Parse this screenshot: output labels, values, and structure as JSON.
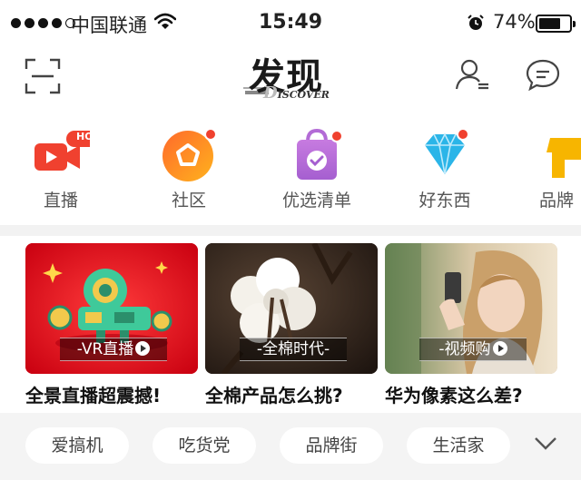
{
  "status_bar": {
    "carrier": "中国联通",
    "time": "15:49",
    "battery": "74%",
    "battery_level": 0.74,
    "signal_icon": "signal-dots-icon",
    "wifi_icon": "wifi-icon",
    "alarm_icon": "alarm-icon"
  },
  "header": {
    "logo_cn": "发现",
    "logo_en": "ISCOVER",
    "left_icon": "scan-icon",
    "right_icons": [
      "user-icon",
      "message-icon"
    ]
  },
  "categories": [
    {
      "label": "直播",
      "icon": "live-video-icon",
      "badge": "HOT",
      "color": "#f0412f"
    },
    {
      "label": "社区",
      "icon": "community-pentagon-icon",
      "color": "#f5821f"
    },
    {
      "label": "优选清单",
      "icon": "shopping-bag-icon",
      "color": "#b36bd6"
    },
    {
      "label": "好东西",
      "icon": "diamond-icon",
      "color": "#2bb5e8"
    },
    {
      "label": "品牌",
      "icon": "brand-store-icon",
      "color": "#f7b500"
    }
  ],
  "cards": [
    {
      "tag": "-VR直播",
      "caption": "全景直播超震撼!",
      "theme": "#e8141b"
    },
    {
      "tag": "-全棉时代-",
      "caption": "全棉产品怎么挑?",
      "theme": "#3a2a20"
    },
    {
      "tag": "-视频购",
      "caption": "华为像素这么差?",
      "theme": "#c9b79a"
    }
  ],
  "chips": [
    "爱搞机",
    "吃货党",
    "品牌街",
    "生活家"
  ],
  "chips_more_icon": "chevron-down-icon"
}
